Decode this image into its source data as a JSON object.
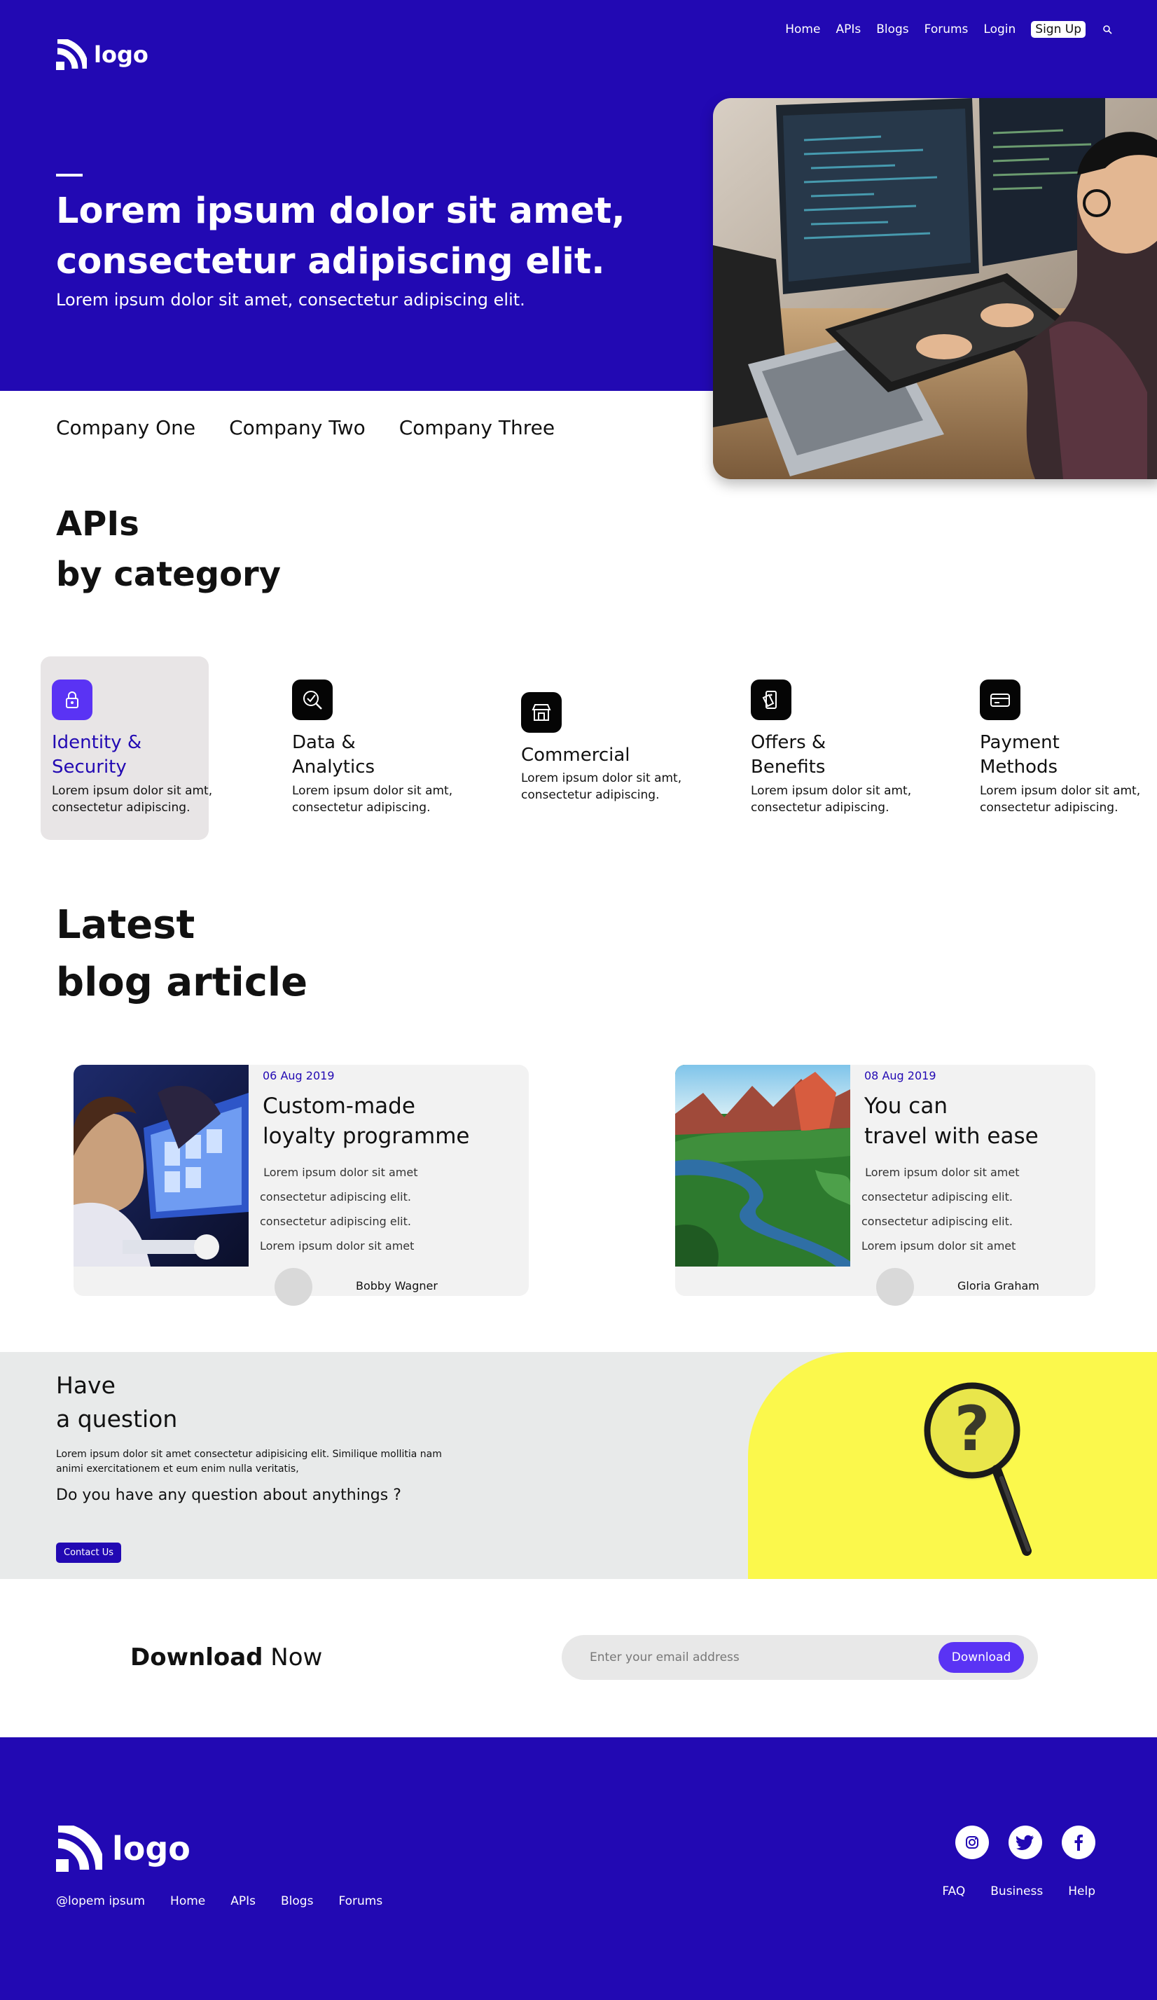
{
  "header": {
    "logo_text": "logo",
    "nav": [
      "Home",
      "APIs",
      "Blogs",
      "Forums",
      "Login"
    ],
    "signup_label": "Sign Up",
    "search_icon": "search-icon"
  },
  "hero": {
    "title": "Lorem ipsum dolor sit amet, consectetur adipiscing elit.",
    "subtitle": "Lorem ipsum dolor sit amet, consectetur adipiscing elit."
  },
  "companies": [
    "Company One",
    "Company Two",
    "Company Three"
  ],
  "apis": {
    "title_line1": "APIs",
    "title_line2": "by category",
    "categories": [
      {
        "name_line1": "Identity &",
        "name_line2": "Security",
        "desc_line1": "Lorem ipsum dolor sit amt,",
        "desc_line2": "consectetur adipiscing.",
        "icon": "lock-icon",
        "active": true
      },
      {
        "name_line1": "Data &",
        "name_line2": "Analytics",
        "desc_line1": "Lorem ipsum dolor sit amt,",
        "desc_line2": "consectetur adipiscing.",
        "icon": "analytics-icon",
        "active": false
      },
      {
        "name_line1": "Commercial",
        "name_line2": "",
        "desc_line1": "Lorem ipsum dolor sit amt,",
        "desc_line2": "consectetur adipiscing.",
        "icon": "store-icon",
        "active": false
      },
      {
        "name_line1": "Offers &",
        "name_line2": "Benefits",
        "desc_line1": "Lorem ipsum dolor sit amt,",
        "desc_line2": "consectetur adipiscing.",
        "icon": "offer-icon",
        "active": false
      },
      {
        "name_line1": "Payment",
        "name_line2": "Methods",
        "desc_line1": "Lorem ipsum dolor sit amt,",
        "desc_line2": "consectetur adipiscing.",
        "icon": "card-icon",
        "active": false
      }
    ]
  },
  "blog": {
    "title_line1": "Latest",
    "title_line2": "blog article",
    "articles": [
      {
        "date": "06 Aug 2019",
        "title_line1": "Custom-made",
        "title_line2": "loyalty programme",
        "excerpt": [
          " Lorem ipsum dolor sit amet",
          "consectetur adipiscing elit.",
          "consectetur adipiscing elit.",
          "Lorem ipsum dolor sit amet"
        ],
        "author": "Bobby Wagner"
      },
      {
        "date": "08 Aug 2019",
        "title_line1": "You can",
        "title_line2": "travel with ease",
        "excerpt": [
          " Lorem ipsum dolor sit amet",
          "consectetur adipiscing elit.",
          "consectetur adipiscing elit.",
          "Lorem ipsum dolor sit amet"
        ],
        "author": "Gloria Graham"
      }
    ]
  },
  "question": {
    "title_line1": "Have",
    "title_line2": "a question",
    "text": "Lorem ipsum dolor sit amet consectetur adipisicing elit. Similique mollitia nam animi exercitationem et eum enim nulla veritatis,",
    "ask": "Do you have any question about anythings ?",
    "button": "Contact Us"
  },
  "download": {
    "label_bold": "Download",
    "label_regular": " Now",
    "placeholder": "Enter your email address",
    "button": "Download"
  },
  "footer": {
    "logo_text": "logo",
    "links": [
      "@lopem ipsum",
      "Home",
      "APIs",
      "Blogs",
      "Forums"
    ],
    "right_links": [
      "FAQ",
      "Business",
      "Help"
    ],
    "social": [
      "instagram-icon",
      "twitter-icon",
      "facebook-icon"
    ]
  },
  "colors": {
    "brand": "#2209b3",
    "accent": "#5a33f4",
    "yellow": "#fbf84c",
    "light_gray": "#e8eaea"
  }
}
